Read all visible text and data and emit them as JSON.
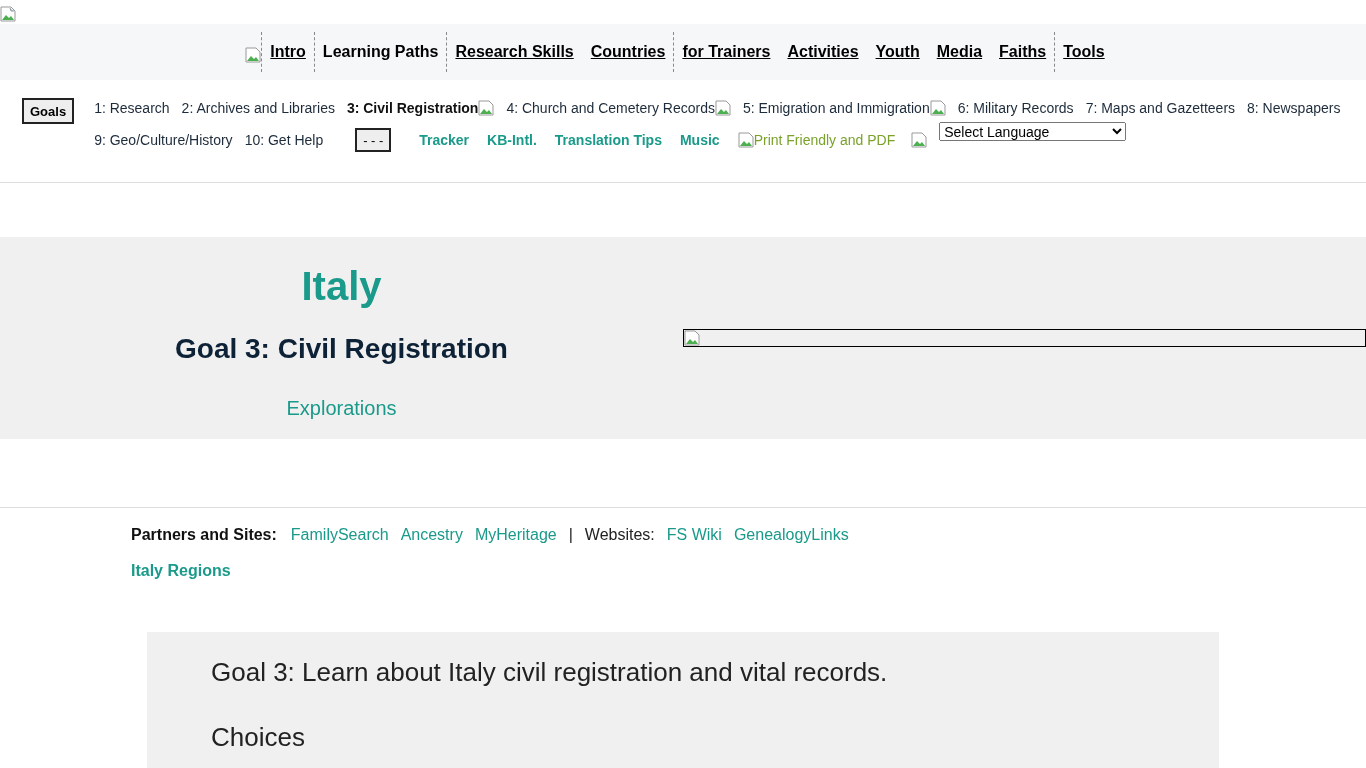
{
  "nav": [
    {
      "label": "Intro",
      "link": true,
      "separator_before": true
    },
    {
      "label": "Learning Paths",
      "link": false,
      "separator_before": true
    },
    {
      "label": "Research Skills",
      "link": true,
      "separator_before": true
    },
    {
      "label": "Countries",
      "link": true,
      "separator_before": false
    },
    {
      "label": "for Trainers",
      "link": true,
      "separator_before": true
    },
    {
      "label": "Activities",
      "link": true,
      "separator_before": false
    },
    {
      "label": "Youth",
      "link": true,
      "separator_before": false
    },
    {
      "label": "Media",
      "link": true,
      "separator_before": false
    },
    {
      "label": "Faiths",
      "link": true,
      "separator_before": false
    },
    {
      "label": "Tools",
      "link": true,
      "separator_before": true
    }
  ],
  "goals_button": "Goals",
  "goals_row_1": [
    {
      "label": "1: Research",
      "selected": false,
      "image_after": false
    },
    {
      "label": "2: Archives and Libraries",
      "selected": false,
      "image_after": false
    },
    {
      "label": "3: Civil Registration",
      "selected": true,
      "image_after": true
    },
    {
      "label": "4: Church and Cemetery Records",
      "selected": false,
      "image_after": true
    },
    {
      "label": "5: Emigration and Immigration",
      "selected": false,
      "image_after": true
    },
    {
      "label": "6: Military Records",
      "selected": false,
      "image_after": false
    },
    {
      "label": "7: Maps and Gazetteers",
      "selected": false,
      "image_after": false
    },
    {
      "label": "8: Newspapers",
      "selected": false,
      "image_after": false
    }
  ],
  "goals_row_2": [
    {
      "label": "9: Geo/Culture/History",
      "selected": false,
      "image_after": false
    },
    {
      "label": "10: Get Help",
      "selected": false,
      "image_after": false
    }
  ],
  "more_button": "- - -",
  "tool_links": [
    "Tracker",
    "KB-Intl.",
    "Translation Tips",
    "Music"
  ],
  "print_link": "Print Friendly and PDF",
  "language_select": {
    "value": "Select Language"
  },
  "hero": {
    "country": "Italy",
    "goal_title": "Goal 3: Civil Registration",
    "link": "Explorations"
  },
  "partners": {
    "label": "Partners and Sites:",
    "links": [
      "FamilySearch",
      "Ancestry",
      "MyHeritage"
    ],
    "separator": "|",
    "websites_label": "Websites:",
    "website_links": [
      "FS Wiki",
      "GenealogyLinks"
    ]
  },
  "regions_link": "Italy Regions",
  "content": {
    "goal_text": "Goal 3: Learn about Italy civil registration and vital records.",
    "heading": "Choices"
  }
}
